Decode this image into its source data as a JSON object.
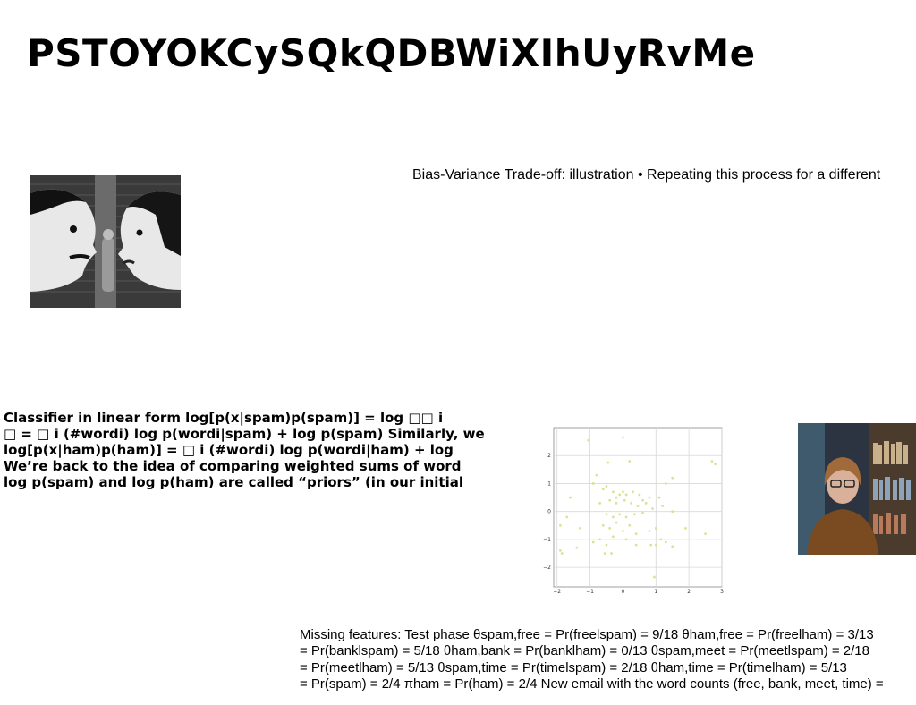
{
  "slide": {
    "title": "PSTOYOKCySQkQDBWiXIhUyRvMe",
    "top_caption": "Bias-Variance Trade-off: illustration • Repeating this process for a different",
    "left_paragraph": [
      "Classifier in linear form log[p(x|spam)p(spam)] = log □□ i",
      "□ = □ i (#wordi) log p(wordi|spam) + log p(spam) Similarly, we",
      "log[p(x|ham)p(ham)] = □ i (#wordi) log p(wordi|ham) + log",
      "We’re back to the idea of comparing weighted sums of word",
      "log p(spam) and log p(ham) are called “priors” (in our initial"
    ],
    "bottom_paragraph": [
      "Missing features: Test phase θspam,free = Pr(freelspam) = 9/18 θham,free = Pr(freelham) = 3/13",
      "= Pr(banklspam) = 5/18 θham,bank = Pr(banklham) = 0/13 θspam,meet = Pr(meetlspam) = 2/18",
      "= Pr(meetlham) = 5/13 θspam,time = Pr(timelspam) = 2/18 θham,time = Pr(timelham) = 5/13",
      "= Pr(spam) = 2/4 πham = Pr(ham) = 2/4 New email with the word counts (free, bank, meet, time) ="
    ],
    "images": {
      "left_photo": "graffiti-mural-photo",
      "right_photo": "woman-at-bookshelf-photo"
    }
  },
  "chart_data": {
    "type": "scatter",
    "title": "",
    "xlabel": "",
    "ylabel": "",
    "xlim": [
      -2.1,
      3.0
    ],
    "ylim": [
      -2.7,
      3.0
    ],
    "xticks": [
      -2,
      -1,
      0,
      1,
      2,
      3
    ],
    "yticks": [
      -2,
      -1,
      0,
      1,
      2
    ],
    "grid": true,
    "point_color": "#d6e08a",
    "series": [
      {
        "points": [
          [
            -1.05,
            2.55
          ],
          [
            0.0,
            2.65
          ],
          [
            -0.45,
            1.75
          ],
          [
            0.2,
            1.8
          ],
          [
            2.7,
            1.8
          ],
          [
            2.8,
            1.7
          ],
          [
            -0.9,
            1.0
          ],
          [
            -0.8,
            1.3
          ],
          [
            1.5,
            1.2
          ],
          [
            1.3,
            1.0
          ],
          [
            -1.6,
            0.5
          ],
          [
            -0.6,
            0.8
          ],
          [
            -0.5,
            0.9
          ],
          [
            -0.3,
            0.7
          ],
          [
            -0.2,
            0.5
          ],
          [
            -0.1,
            0.6
          ],
          [
            0.0,
            0.7
          ],
          [
            0.1,
            0.6
          ],
          [
            0.3,
            0.7
          ],
          [
            0.5,
            0.6
          ],
          [
            0.6,
            0.4
          ],
          [
            0.8,
            0.5
          ],
          [
            -0.7,
            0.3
          ],
          [
            -0.4,
            0.4
          ],
          [
            -0.2,
            0.3
          ],
          [
            0.05,
            0.4
          ],
          [
            0.25,
            0.3
          ],
          [
            0.45,
            0.2
          ],
          [
            0.7,
            0.3
          ],
          [
            1.1,
            0.5
          ],
          [
            1.2,
            0.2
          ],
          [
            1.5,
            0.0
          ],
          [
            -1.9,
            -0.5
          ],
          [
            -1.7,
            -0.2
          ],
          [
            -0.5,
            -0.1
          ],
          [
            -0.3,
            -0.2
          ],
          [
            -0.1,
            -0.1
          ],
          [
            0.1,
            -0.2
          ],
          [
            0.35,
            -0.1
          ],
          [
            0.6,
            -0.05
          ],
          [
            0.9,
            0.1
          ],
          [
            -0.6,
            -0.5
          ],
          [
            -0.4,
            -0.6
          ],
          [
            -0.2,
            -0.4
          ],
          [
            0.0,
            -0.7
          ],
          [
            0.2,
            -0.5
          ],
          [
            0.4,
            -0.8
          ],
          [
            0.8,
            -0.7
          ],
          [
            1.0,
            -0.6
          ],
          [
            1.9,
            -0.6
          ],
          [
            2.5,
            -0.8
          ],
          [
            -1.3,
            -0.6
          ],
          [
            -0.9,
            -1.1
          ],
          [
            -0.7,
            -1.0
          ],
          [
            -0.5,
            -1.2
          ],
          [
            -0.3,
            -0.9
          ],
          [
            0.1,
            -1.0
          ],
          [
            0.4,
            -1.2
          ],
          [
            0.85,
            -1.2
          ],
          [
            1.0,
            -1.2
          ],
          [
            1.15,
            -1.0
          ],
          [
            1.3,
            -1.1
          ],
          [
            1.5,
            -1.25
          ],
          [
            -1.4,
            -1.3
          ],
          [
            -1.9,
            -1.4
          ],
          [
            -1.85,
            -1.5
          ],
          [
            -0.55,
            -1.5
          ],
          [
            -0.35,
            -1.5
          ],
          [
            0.95,
            -2.35
          ]
        ]
      }
    ]
  }
}
